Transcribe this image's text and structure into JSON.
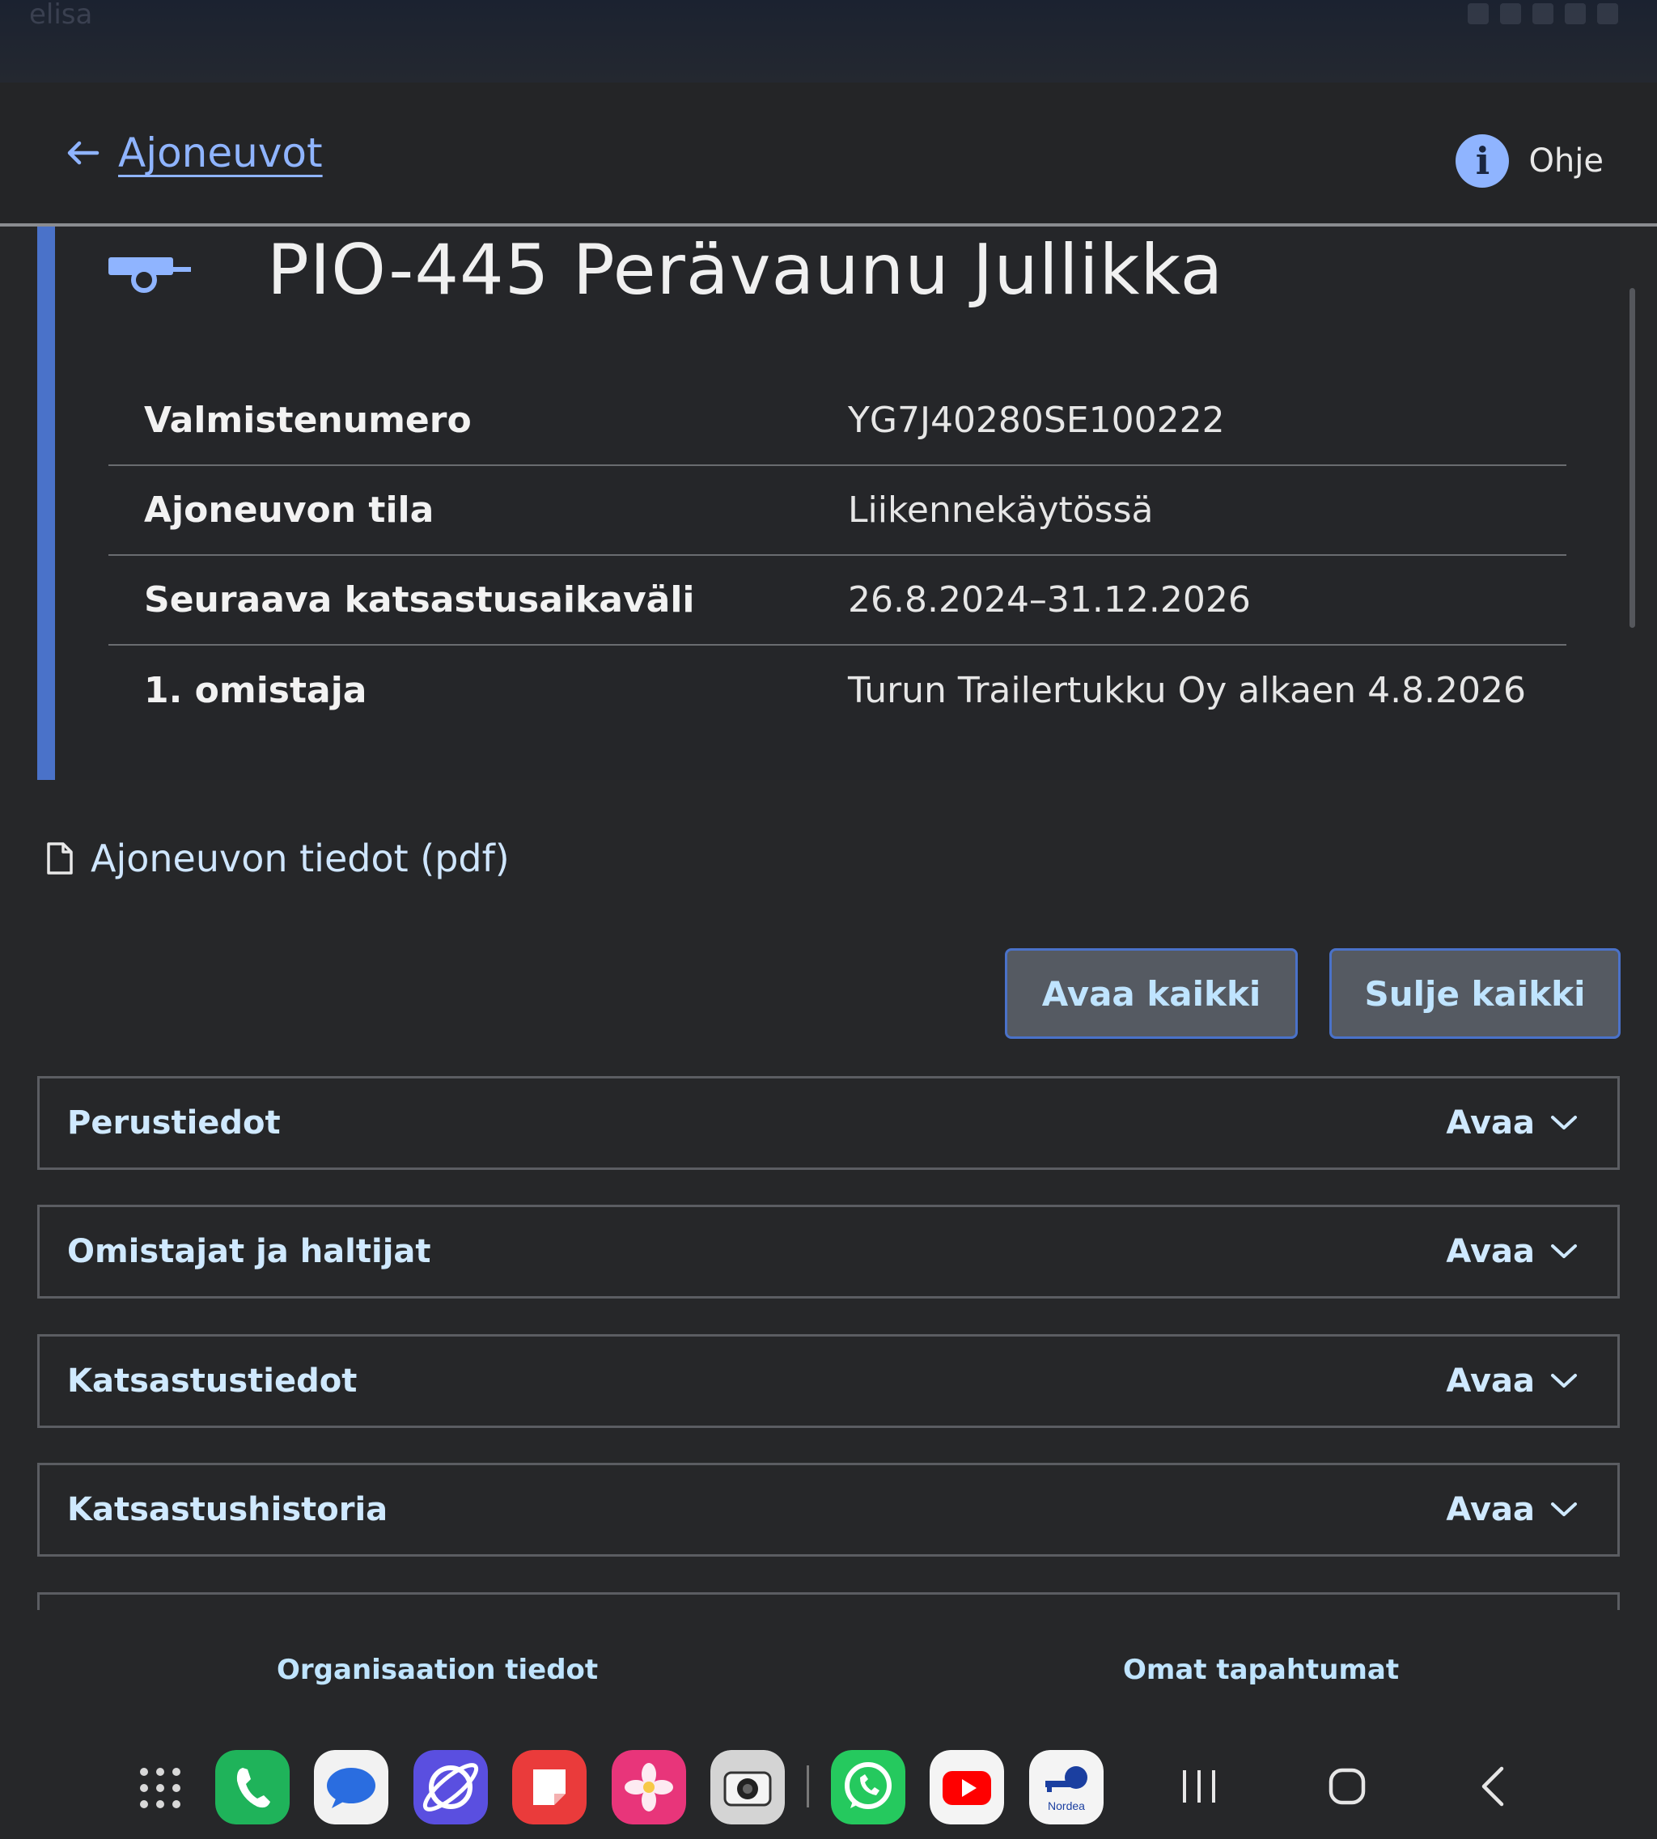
{
  "status_bar": {
    "carrier": "elisa"
  },
  "header": {
    "back_label": "Ajoneuvot",
    "help_label": "Ohje",
    "help_icon_glyph": "i"
  },
  "vehicle": {
    "title": "PIO-445 Perävaunu Jullikka",
    "rows": [
      {
        "key": "Valmistenumero",
        "value": "YG7J40280SE100222"
      },
      {
        "key": "Ajoneuvon tila",
        "value": "Liikennekäytössä"
      },
      {
        "key": "Seuraava katsastusaikaväli",
        "value": "26.8.2024–31.12.2026"
      },
      {
        "key": "1. omistaja",
        "value": "Turun Trailertukku Oy alkaen 4.8.2026"
      }
    ]
  },
  "pdf_link": {
    "label": "Ajoneuvon tiedot (pdf)"
  },
  "actions": {
    "open_all": "Avaa kaikki",
    "close_all": "Sulje kaikki"
  },
  "sections": [
    {
      "title": "Perustiedot",
      "toggle": "Avaa"
    },
    {
      "title": "Omistajat ja haltijat",
      "toggle": "Avaa"
    },
    {
      "title": "Katsastustiedot",
      "toggle": "Avaa"
    },
    {
      "title": "Katsastushistoria",
      "toggle": "Avaa"
    }
  ],
  "bottom_nav": {
    "organisation": "Organisaation tiedot",
    "events": "Omat tapahtumat"
  },
  "dock": {
    "apps": [
      "phone-app-icon",
      "messages-app-icon",
      "internet-app-icon",
      "notes-app-icon",
      "gallery-app-icon",
      "camera-app-icon",
      "whatsapp-app-icon",
      "youtube-app-icon",
      "nordea-app-icon"
    ],
    "nordea_label": "Nordea"
  },
  "colors": {
    "accent": "#4a72c9",
    "link": "#8fb4ff",
    "background": "#262729",
    "button_bg": "#555a62"
  }
}
